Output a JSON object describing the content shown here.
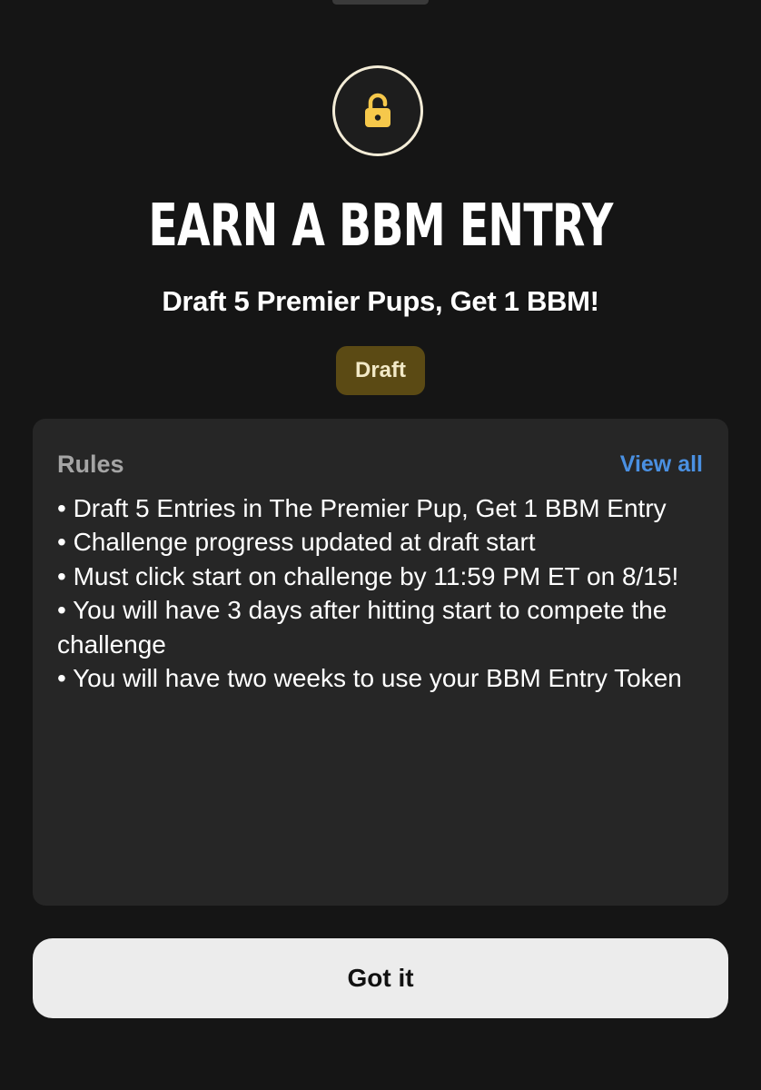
{
  "modal": {
    "icon": "unlocked-padlock-icon",
    "title": "EARN A BBM ENTRY",
    "subtitle": "Draft 5 Premier Pups, Get 1 BBM!",
    "tag_label": "Draft",
    "accent_color": "#f6c84b",
    "tag_bg_color": "#5b4a14"
  },
  "rules": {
    "title": "Rules",
    "view_all_label": "View all",
    "items": [
      "• Draft 5 Entries in The Premier Pup, Get 1 BBM Entry",
      "• Challenge progress updated at draft start",
      "• Must click start on challenge by 11:59 PM ET on 8/15!",
      "• You will have 3 days after hitting start to compete the challenge",
      "• You will have two weeks to use your BBM Entry Token"
    ]
  },
  "footer": {
    "button_label": "Got it"
  }
}
